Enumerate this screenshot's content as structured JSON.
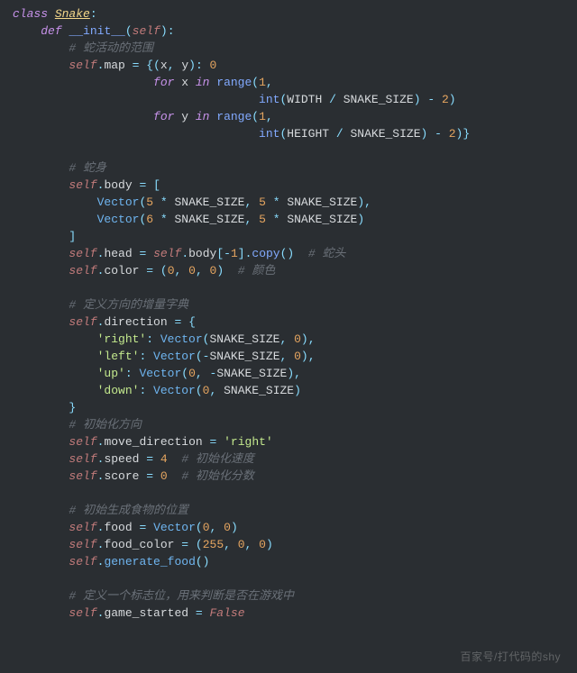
{
  "watermark": "百家号/打代码的shy",
  "code": {
    "language": "python",
    "class_name": "Snake",
    "method": "__init__",
    "constants": [
      "WIDTH",
      "HEIGHT",
      "SNAKE_SIZE"
    ],
    "tokens": [
      [
        [
          "kw",
          "class "
        ],
        [
          "cls",
          "Snake"
        ],
        [
          "punct",
          ":"
        ]
      ],
      [
        [
          "pad",
          "    "
        ],
        [
          "kw",
          "def "
        ],
        [
          "func",
          "__init__"
        ],
        [
          "punct",
          "("
        ],
        [
          "self",
          "self"
        ],
        [
          "punct",
          "):"
        ]
      ],
      [
        [
          "pad",
          "        "
        ],
        [
          "cmt",
          "# 蛇活动的范围"
        ]
      ],
      [
        [
          "pad",
          "        "
        ],
        [
          "self",
          "self"
        ],
        [
          "punct",
          "."
        ],
        [
          "attr",
          "map "
        ],
        [
          "op",
          "="
        ],
        [
          "attr",
          " "
        ],
        [
          "punct",
          "{("
        ],
        [
          "attr",
          "x"
        ],
        [
          "punct",
          ", "
        ],
        [
          "attr",
          "y"
        ],
        [
          "punct",
          "): "
        ],
        [
          "num",
          "0"
        ]
      ],
      [
        [
          "pad",
          "                    "
        ],
        [
          "kw",
          "for "
        ],
        [
          "attr",
          "x"
        ],
        [
          "kw",
          " in "
        ],
        [
          "func",
          "range"
        ],
        [
          "punct",
          "("
        ],
        [
          "num",
          "1"
        ],
        [
          "punct",
          ","
        ]
      ],
      [
        [
          "pad",
          "                                   "
        ],
        [
          "func",
          "int"
        ],
        [
          "punct",
          "("
        ],
        [
          "const",
          "WIDTH"
        ],
        [
          "op",
          " / "
        ],
        [
          "const",
          "SNAKE_SIZE"
        ],
        [
          "punct",
          ") "
        ],
        [
          "op",
          "-"
        ],
        [
          "attr",
          " "
        ],
        [
          "num",
          "2"
        ],
        [
          "punct",
          ")"
        ]
      ],
      [
        [
          "pad",
          "                    "
        ],
        [
          "kw",
          "for "
        ],
        [
          "attr",
          "y"
        ],
        [
          "kw",
          " in "
        ],
        [
          "func",
          "range"
        ],
        [
          "punct",
          "("
        ],
        [
          "num",
          "1"
        ],
        [
          "punct",
          ","
        ]
      ],
      [
        [
          "pad",
          "                                   "
        ],
        [
          "func",
          "int"
        ],
        [
          "punct",
          "("
        ],
        [
          "const",
          "HEIGHT"
        ],
        [
          "op",
          " / "
        ],
        [
          "const",
          "SNAKE_SIZE"
        ],
        [
          "punct",
          ") "
        ],
        [
          "op",
          "-"
        ],
        [
          "attr",
          " "
        ],
        [
          "num",
          "2"
        ],
        [
          "punct",
          ")}"
        ]
      ],
      [
        [
          "pad",
          ""
        ]
      ],
      [
        [
          "pad",
          "        "
        ],
        [
          "cmt",
          "# 蛇身"
        ]
      ],
      [
        [
          "pad",
          "        "
        ],
        [
          "self",
          "self"
        ],
        [
          "punct",
          "."
        ],
        [
          "attr",
          "body "
        ],
        [
          "op",
          "="
        ],
        [
          "attr",
          " "
        ],
        [
          "punct",
          "["
        ]
      ],
      [
        [
          "pad",
          "            "
        ],
        [
          "call",
          "Vector"
        ],
        [
          "punct",
          "("
        ],
        [
          "num",
          "5"
        ],
        [
          "op",
          " * "
        ],
        [
          "const",
          "SNAKE_SIZE"
        ],
        [
          "punct",
          ", "
        ],
        [
          "num",
          "5"
        ],
        [
          "op",
          " * "
        ],
        [
          "const",
          "SNAKE_SIZE"
        ],
        [
          "punct",
          "),"
        ]
      ],
      [
        [
          "pad",
          "            "
        ],
        [
          "call",
          "Vector"
        ],
        [
          "punct",
          "("
        ],
        [
          "num",
          "6"
        ],
        [
          "op",
          " * "
        ],
        [
          "const",
          "SNAKE_SIZE"
        ],
        [
          "punct",
          ", "
        ],
        [
          "num",
          "5"
        ],
        [
          "op",
          " * "
        ],
        [
          "const",
          "SNAKE_SIZE"
        ],
        [
          "punct",
          ")"
        ]
      ],
      [
        [
          "pad",
          "        "
        ],
        [
          "punct",
          "]"
        ]
      ],
      [
        [
          "pad",
          "        "
        ],
        [
          "self",
          "self"
        ],
        [
          "punct",
          "."
        ],
        [
          "attr",
          "head "
        ],
        [
          "op",
          "="
        ],
        [
          "attr",
          " "
        ],
        [
          "self",
          "self"
        ],
        [
          "punct",
          "."
        ],
        [
          "attr",
          "body"
        ],
        [
          "punct",
          "["
        ],
        [
          "op",
          "-"
        ],
        [
          "num",
          "1"
        ],
        [
          "punct",
          "]."
        ],
        [
          "func",
          "copy"
        ],
        [
          "punct",
          "()  "
        ],
        [
          "cmt",
          "# 蛇头"
        ]
      ],
      [
        [
          "pad",
          "        "
        ],
        [
          "self",
          "self"
        ],
        [
          "punct",
          "."
        ],
        [
          "attr",
          "color "
        ],
        [
          "op",
          "="
        ],
        [
          "attr",
          " "
        ],
        [
          "punct",
          "("
        ],
        [
          "num",
          "0"
        ],
        [
          "punct",
          ", "
        ],
        [
          "num",
          "0"
        ],
        [
          "punct",
          ", "
        ],
        [
          "num",
          "0"
        ],
        [
          "punct",
          ")  "
        ],
        [
          "cmt",
          "# 颜色"
        ]
      ],
      [
        [
          "pad",
          ""
        ]
      ],
      [
        [
          "pad",
          "        "
        ],
        [
          "cmt",
          "# 定义方向的增量字典"
        ]
      ],
      [
        [
          "pad",
          "        "
        ],
        [
          "self",
          "self"
        ],
        [
          "punct",
          "."
        ],
        [
          "attr",
          "direction "
        ],
        [
          "op",
          "="
        ],
        [
          "attr",
          " "
        ],
        [
          "punct",
          "{"
        ]
      ],
      [
        [
          "pad",
          "            "
        ],
        [
          "str",
          "'right'"
        ],
        [
          "punct",
          ": "
        ],
        [
          "call",
          "Vector"
        ],
        [
          "punct",
          "("
        ],
        [
          "const",
          "SNAKE_SIZE"
        ],
        [
          "punct",
          ", "
        ],
        [
          "num",
          "0"
        ],
        [
          "punct",
          "),"
        ]
      ],
      [
        [
          "pad",
          "            "
        ],
        [
          "str",
          "'left'"
        ],
        [
          "punct",
          ": "
        ],
        [
          "call",
          "Vector"
        ],
        [
          "punct",
          "("
        ],
        [
          "op",
          "-"
        ],
        [
          "const",
          "SNAKE_SIZE"
        ],
        [
          "punct",
          ", "
        ],
        [
          "num",
          "0"
        ],
        [
          "punct",
          "),"
        ]
      ],
      [
        [
          "pad",
          "            "
        ],
        [
          "str",
          "'up'"
        ],
        [
          "punct",
          ": "
        ],
        [
          "call",
          "Vector"
        ],
        [
          "punct",
          "("
        ],
        [
          "num",
          "0"
        ],
        [
          "punct",
          ", "
        ],
        [
          "op",
          "-"
        ],
        [
          "const",
          "SNAKE_SIZE"
        ],
        [
          "punct",
          "),"
        ]
      ],
      [
        [
          "pad",
          "            "
        ],
        [
          "str",
          "'down'"
        ],
        [
          "punct",
          ": "
        ],
        [
          "call",
          "Vector"
        ],
        [
          "punct",
          "("
        ],
        [
          "num",
          "0"
        ],
        [
          "punct",
          ", "
        ],
        [
          "const",
          "SNAKE_SIZE"
        ],
        [
          "punct",
          ")"
        ]
      ],
      [
        [
          "pad",
          "        "
        ],
        [
          "punct",
          "}"
        ]
      ],
      [
        [
          "pad",
          "        "
        ],
        [
          "cmt",
          "# 初始化方向"
        ]
      ],
      [
        [
          "pad",
          "        "
        ],
        [
          "self",
          "self"
        ],
        [
          "punct",
          "."
        ],
        [
          "attr",
          "move_direction "
        ],
        [
          "op",
          "="
        ],
        [
          "attr",
          " "
        ],
        [
          "str",
          "'right'"
        ]
      ],
      [
        [
          "pad",
          "        "
        ],
        [
          "self",
          "self"
        ],
        [
          "punct",
          "."
        ],
        [
          "attr",
          "speed "
        ],
        [
          "op",
          "="
        ],
        [
          "attr",
          " "
        ],
        [
          "num",
          "4"
        ],
        [
          "attr",
          "  "
        ],
        [
          "cmt",
          "# 初始化速度"
        ]
      ],
      [
        [
          "pad",
          "        "
        ],
        [
          "self",
          "self"
        ],
        [
          "punct",
          "."
        ],
        [
          "attr",
          "score "
        ],
        [
          "op",
          "="
        ],
        [
          "attr",
          " "
        ],
        [
          "num",
          "0"
        ],
        [
          "attr",
          "  "
        ],
        [
          "cmt",
          "# 初始化分数"
        ]
      ],
      [
        [
          "pad",
          ""
        ]
      ],
      [
        [
          "pad",
          "        "
        ],
        [
          "cmt",
          "# 初始生成食物的位置"
        ]
      ],
      [
        [
          "pad",
          "        "
        ],
        [
          "self",
          "self"
        ],
        [
          "punct",
          "."
        ],
        [
          "attr",
          "food "
        ],
        [
          "op",
          "="
        ],
        [
          "attr",
          " "
        ],
        [
          "call",
          "Vector"
        ],
        [
          "punct",
          "("
        ],
        [
          "num",
          "0"
        ],
        [
          "punct",
          ", "
        ],
        [
          "num",
          "0"
        ],
        [
          "punct",
          ")"
        ]
      ],
      [
        [
          "pad",
          "        "
        ],
        [
          "self",
          "self"
        ],
        [
          "punct",
          "."
        ],
        [
          "attr",
          "food_color "
        ],
        [
          "op",
          "="
        ],
        [
          "attr",
          " "
        ],
        [
          "punct",
          "("
        ],
        [
          "num",
          "255"
        ],
        [
          "punct",
          ", "
        ],
        [
          "num",
          "0"
        ],
        [
          "punct",
          ", "
        ],
        [
          "num",
          "0"
        ],
        [
          "punct",
          ")"
        ]
      ],
      [
        [
          "pad",
          "        "
        ],
        [
          "self",
          "self"
        ],
        [
          "punct",
          "."
        ],
        [
          "call",
          "generate_food"
        ],
        [
          "punct",
          "()"
        ]
      ],
      [
        [
          "pad",
          ""
        ]
      ],
      [
        [
          "pad",
          "        "
        ],
        [
          "cmt",
          "# 定义一个标志位，用来判断是否在游戏中"
        ]
      ],
      [
        [
          "pad",
          "        "
        ],
        [
          "self",
          "self"
        ],
        [
          "punct",
          "."
        ],
        [
          "attr",
          "game_started "
        ],
        [
          "op",
          "="
        ],
        [
          "attr",
          " "
        ],
        [
          "bool",
          "False"
        ]
      ]
    ]
  }
}
